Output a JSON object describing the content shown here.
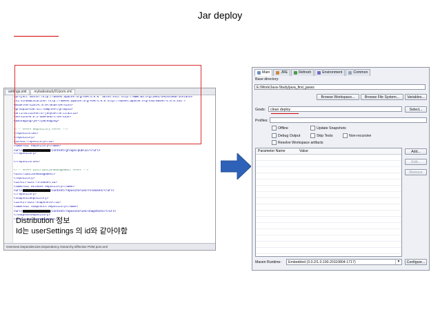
{
  "title": "Jar deploy",
  "xml_editor": {
    "tabs": [
      "settings.xml",
      "mybatisstudy01/pom.xml"
    ],
    "lines": [
      "<project xmlns=\"http://maven.apache.org/POM/4.0.0\" xmlns:xsi=\"http://www.w3.org/2001/XMLSchema-instance\"",
      "  xsi:schemaLocation=\"http://maven.apache.org/POM/4.0.0 http://maven.apache.org/xsd/maven-4.0.0.xsd\">",
      "  <modelVersion>4.0.0</modelVersion>",
      "  <groupId>com.sil.samples</groupId>",
      "  <artifactId>hello-jeoyou</artifactId>",
      "  <version>0.0.1-SNAPSHOT</version>",
      "  <packaging>jar</packaging>",
      "",
      "  <!-- ##### Repository ##### -->",
      "  <repositories>",
      "    <repository>",
      "      <id>SIL-repository</id>",
      "      <name>SIL Repository</name>",
      "      <url>                /content/groups/public/</url>",
      "    </repository>",
      "",
      "  </repositories>",
      "",
      "  <!-- ##### DistributionManagement ##### -->",
      "  <distributionManagement>",
      "    <repository>",
      "      <id>sil-dist-release</id>",
      "      <name>SIL Release Repository</name>",
      "      <url>                /content/repositories/releases/</url>",
      "    </repository>",
      "    <snapshotRepository>",
      "      <id>sil-dist-snapshots</id>",
      "      <name>SIL Snapshots Repository</name>",
      "      <url>                /content/repositories/snapshots/</url>",
      "    </snapshotRepository>",
      "  </distributionManagement>"
    ],
    "bottom_tabs": "Overview  Dependencies  Dependency Hierarchy  Effective POM  pom.xml"
  },
  "annotation": {
    "line1": "Distribution 정보",
    "line2": "Id는 userSettings 의 id와 같아야함"
  },
  "dialog": {
    "tabs": [
      {
        "label": "Main",
        "icon_color": "#6b8fc9"
      },
      {
        "label": "JRE",
        "icon_color": "#c98a3a"
      },
      {
        "label": "Refresh",
        "icon_color": "#4c9a4c"
      },
      {
        "label": "Environment",
        "icon_color": "#7a6cc4"
      },
      {
        "label": "Common",
        "icon_color": "#9aa4b6"
      }
    ],
    "base_dir_label": "Base directory:",
    "base_dir_value": "E:/Work/Java-Study/java_first_jaxws",
    "browse_workspace": "Browse Workspace...",
    "browse_fs": "Browse File System...",
    "variables": "Variables...",
    "goals_label": "Goals:",
    "goals_value": "clean deploy",
    "select": "Select...",
    "profiles_label": "Profiles:",
    "checks": [
      "Offline",
      "Update Snapshots",
      "Debug Output",
      "Skip Tests",
      "Non-recursive",
      "Resolve Workspace artifacts"
    ],
    "table_headers": [
      "Parameter Name",
      "Value"
    ],
    "add": "Add...",
    "edit": "Edit...",
    "remove": "Remove",
    "runtime_label": "Maven Runtime:",
    "runtime_value": "Embedded (3.0.2/1.0.100.20110804-1717)",
    "configure": "Configure..."
  }
}
